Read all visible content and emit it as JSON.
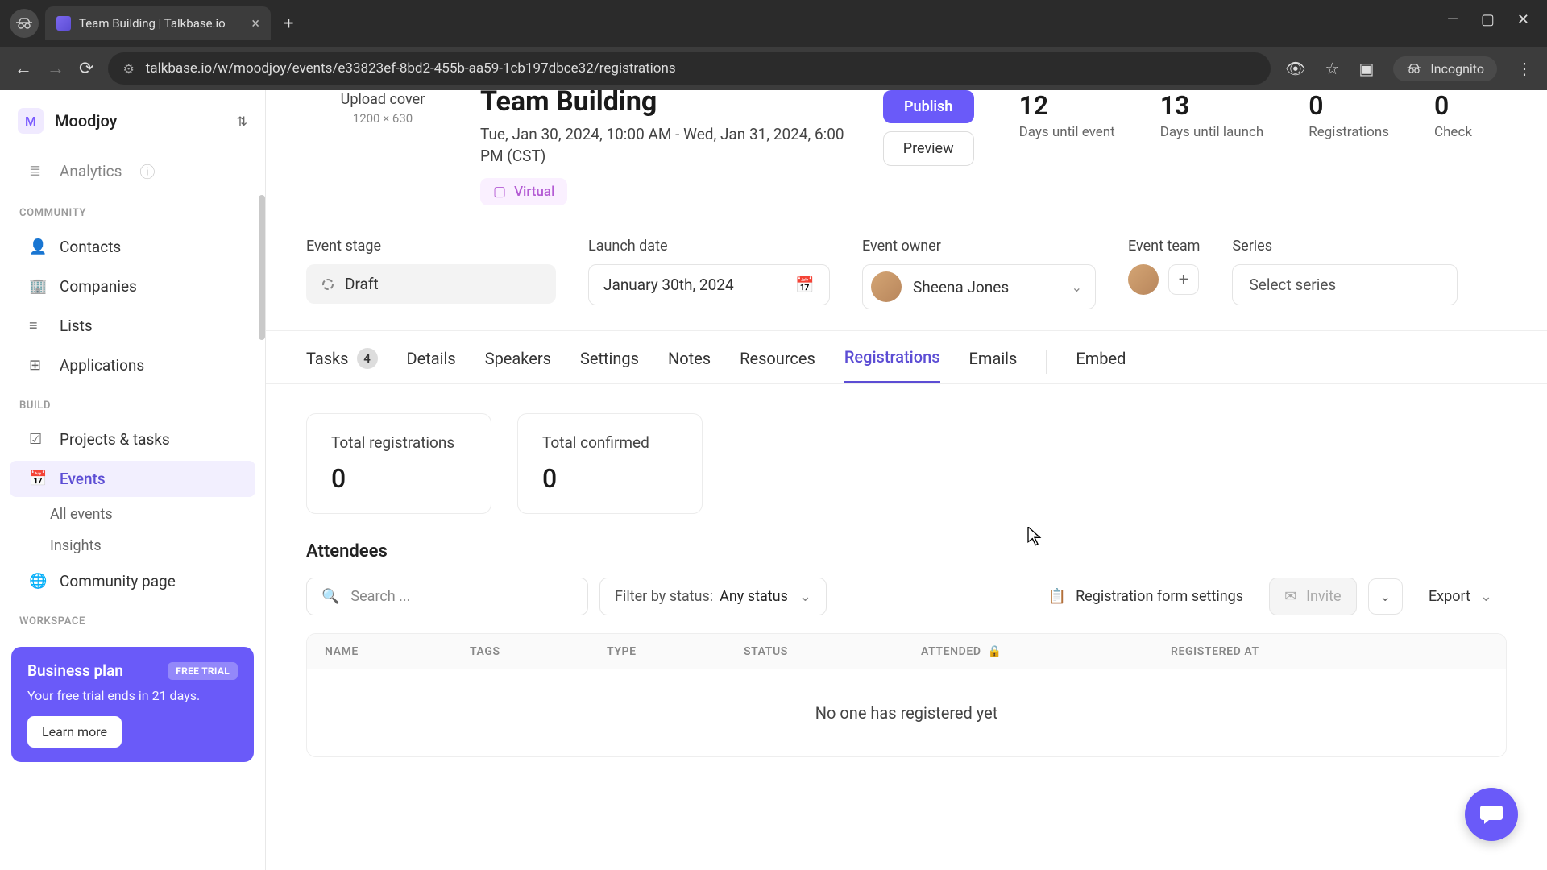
{
  "browser": {
    "tab_title": "Team Building | Talkbase.io",
    "url": "talkbase.io/w/moodjoy/events/e33823ef-8bd2-455b-aa59-1cb197dbce32/registrations",
    "incognito_label": "Incognito"
  },
  "workspace": {
    "initial": "M",
    "name": "Moodjoy"
  },
  "sidebar": {
    "analytics": "Analytics",
    "community_heading": "COMMUNITY",
    "contacts": "Contacts",
    "companies": "Companies",
    "lists": "Lists",
    "applications": "Applications",
    "build_heading": "BUILD",
    "projects": "Projects & tasks",
    "events": "Events",
    "all_events": "All events",
    "insights": "Insights",
    "community_page": "Community page",
    "workspace_heading": "WORKSPACE"
  },
  "trial": {
    "title": "Business plan",
    "badge": "FREE TRIAL",
    "subtitle": "Your free trial ends in 21 days.",
    "button": "Learn more"
  },
  "event": {
    "cover_upload": "Upload cover",
    "cover_size": "1200 × 630",
    "title": "Team Building",
    "date_range": "Tue, Jan 30, 2024, 10:00 AM - Wed, Jan 31, 2024, 6:00 PM (CST)",
    "virtual": "Virtual",
    "publish": "Publish",
    "preview": "Preview"
  },
  "stats": [
    {
      "value": "12",
      "label": "Days until event"
    },
    {
      "value": "13",
      "label": "Days until launch"
    },
    {
      "value": "0",
      "label": "Registrations"
    },
    {
      "value": "0",
      "label": "Check"
    }
  ],
  "meta": {
    "stage_label": "Event stage",
    "stage_value": "Draft",
    "launch_label": "Launch date",
    "launch_value": "January 30th, 2024",
    "owner_label": "Event owner",
    "owner_name": "Sheena Jones",
    "team_label": "Event team",
    "series_label": "Series",
    "series_placeholder": "Select series"
  },
  "tabs": {
    "tasks": "Tasks",
    "tasks_badge": "4",
    "details": "Details",
    "speakers": "Speakers",
    "settings": "Settings",
    "notes": "Notes",
    "resources": "Resources",
    "registrations": "Registrations",
    "emails": "Emails",
    "embed": "Embed"
  },
  "panels": {
    "total_reg_label": "Total registrations",
    "total_reg_value": "0",
    "total_conf_label": "Total confirmed",
    "total_conf_value": "0"
  },
  "attendees": {
    "heading": "Attendees",
    "search_placeholder": "Search ...",
    "filter_label": "Filter by status:",
    "filter_value": "Any status",
    "form_settings": "Registration form settings",
    "invite": "Invite",
    "export": "Export",
    "col_name": "NAME",
    "col_tags": "TAGS",
    "col_type": "TYPE",
    "col_status": "STATUS",
    "col_attended": "ATTENDED",
    "col_registered": "REGISTERED AT",
    "empty": "No one has registered yet"
  }
}
